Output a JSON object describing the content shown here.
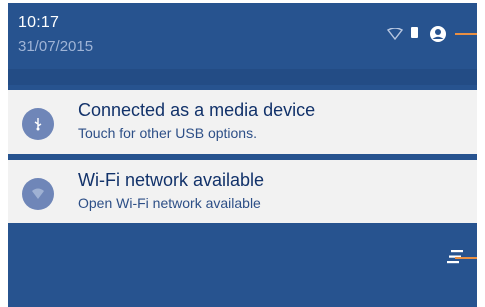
{
  "status_bar": {
    "time": "10:17",
    "date": "31/07/2015",
    "icons": [
      "wifi-icon",
      "battery-icon",
      "account-icon"
    ]
  },
  "notifications": [
    {
      "icon": "usb-icon",
      "title": "Connected as a media device",
      "subtitle": "Touch for other USB options."
    },
    {
      "icon": "wifi-icon",
      "title": "Wi-Fi network available",
      "subtitle": "Open Wi-Fi network available"
    }
  ],
  "actions": {
    "clear_all_icon": "clear-all-icon"
  },
  "colors": {
    "background": "#27538f",
    "card": "#f2f2f2",
    "title_text": "#12326a",
    "subtitle_text": "#2d4f87",
    "callout": "#e98f43"
  }
}
